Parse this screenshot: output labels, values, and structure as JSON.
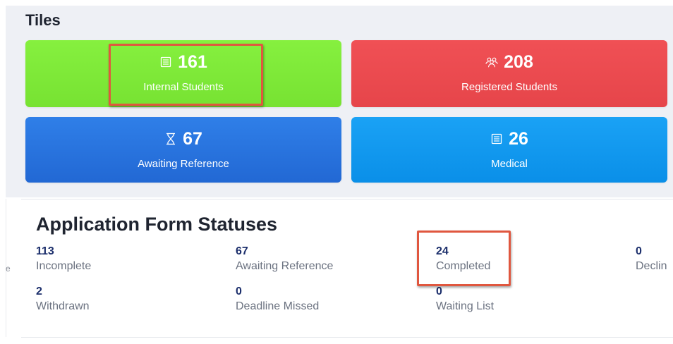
{
  "tiles": {
    "title": "Tiles",
    "items": [
      {
        "value": "161",
        "label": "Internal Students",
        "icon": "list-icon",
        "color": "#7fe839"
      },
      {
        "value": "208",
        "label": "Registered Students",
        "icon": "users-icon",
        "color": "#eb4a4f"
      },
      {
        "value": "67",
        "label": "Awaiting Reference",
        "icon": "hourglass-icon",
        "color": "#2873de"
      },
      {
        "value": "26",
        "label": "Medical",
        "icon": "list-icon",
        "color": "#0f97ee"
      }
    ]
  },
  "statuses": {
    "title": "Application Form Statuses",
    "items": [
      {
        "value": "113",
        "label": "Incomplete"
      },
      {
        "value": "67",
        "label": "Awaiting Reference"
      },
      {
        "value": "24",
        "label": "Completed"
      },
      {
        "value": "0",
        "label": "Declin"
      },
      {
        "value": "2",
        "label": "Withdrawn"
      },
      {
        "value": "0",
        "label": "Deadline Missed"
      },
      {
        "value": "0",
        "label": "Waiting List"
      }
    ]
  },
  "edge_fragment": "e",
  "highlight_color": "#e0573f"
}
